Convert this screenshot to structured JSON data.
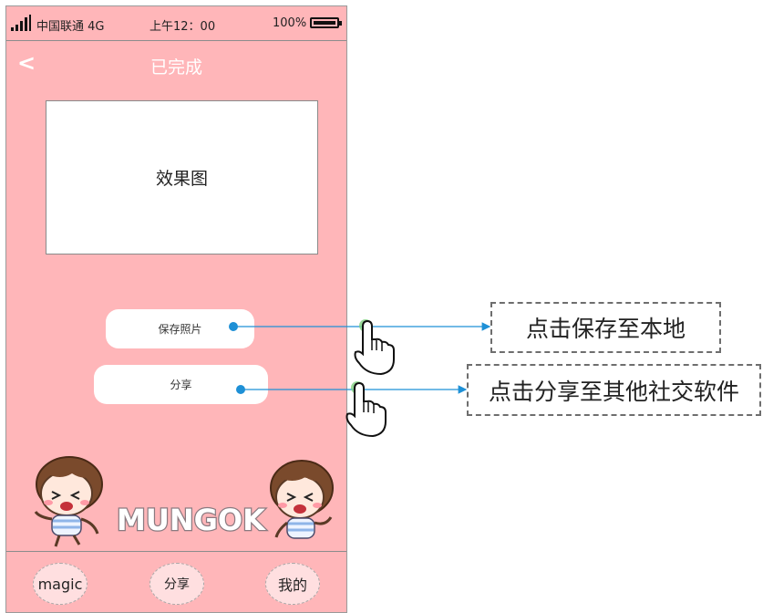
{
  "statusbar": {
    "carrier": "中国联通 4G",
    "time": "上午12：00",
    "battery": "100%"
  },
  "header": {
    "back": "<",
    "title": "已完成"
  },
  "preview": {
    "label": "效果图"
  },
  "actions": {
    "save_label": "保存照片",
    "share_label": "分享"
  },
  "brand": {
    "logo_text": "MUNGOK"
  },
  "tabbar": {
    "items": [
      {
        "label": "magic"
      },
      {
        "label": "分享"
      },
      {
        "label": "我的"
      }
    ]
  },
  "annotations": {
    "save_note": "点击保存至本地",
    "share_note": "点击分享至其他社交软件"
  },
  "colors": {
    "phone_bg": "#ffb6b9",
    "connector": "#1e90d6",
    "tab_bg": "#ffdfe0"
  }
}
